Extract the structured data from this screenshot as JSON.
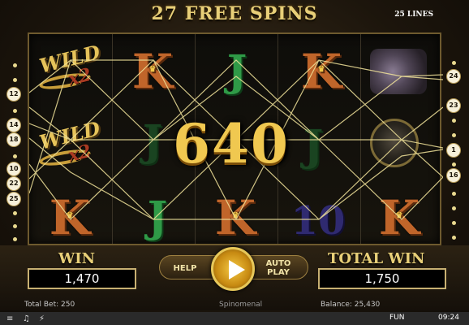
{
  "header": {
    "title": "27 FREE SPINS",
    "lines_label": "25 LINES"
  },
  "paylines": {
    "left": [
      "12",
      "14",
      "18",
      "10",
      "22",
      "25"
    ],
    "right": [
      "24",
      "23",
      "1",
      "16"
    ]
  },
  "reels": {
    "symbols": [
      [
        "WILD x2",
        "WILD x2",
        "K"
      ],
      [
        "K",
        "J",
        "J"
      ],
      [
        "J",
        "",
        "K"
      ],
      [
        "K",
        "J",
        "10"
      ],
      [
        "crystals",
        "pocket-watch",
        "K"
      ]
    ],
    "wild_text": "WILD",
    "wild_multiplier": "x2"
  },
  "win_amount": "640",
  "panel": {
    "win_label": "WIN",
    "win_value": "1,470",
    "total_win_label": "TOTAL WIN",
    "total_win_value": "1,750",
    "help_label": "HELP",
    "auto_label_1": "AUTO",
    "auto_label_2": "PLAY"
  },
  "status": {
    "total_bet": "Total Bet: 250",
    "provider": "Spinomenal",
    "balance": "Balance: 25,430"
  },
  "sysbar": {
    "mode": "FUN",
    "time": "09:24"
  },
  "colors": {
    "gold": "#e8cf78",
    "k_symbol": "#c0652a",
    "j_symbol": "#2f9a47",
    "ten_symbol": "#2f2a70",
    "payline": "#f1e39a"
  }
}
